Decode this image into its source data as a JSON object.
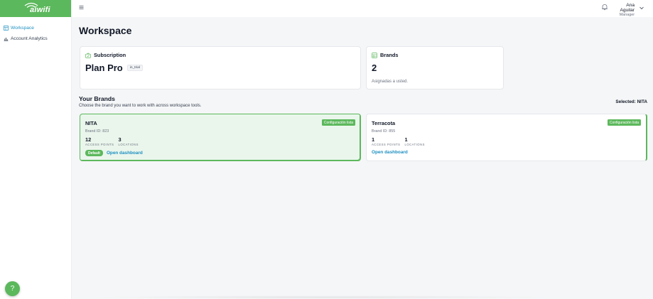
{
  "app": {
    "logo_text": "aiwifi",
    "brand_color": "#5cb85c",
    "link_color": "#1d8fc1"
  },
  "sidebar": {
    "items": [
      {
        "label": "Workspace",
        "icon": "workspace-icon",
        "active": true
      },
      {
        "label": "Account Analytics",
        "icon": "analytics-icon",
        "active": false
      }
    ],
    "help_label": "?"
  },
  "topbar": {
    "user_name": "Ana Aguilar",
    "user_role": "Manager"
  },
  "page": {
    "title": "Workspace"
  },
  "subscription": {
    "heading": "Subscription",
    "plan": "Plan Pro",
    "status": "in_trial"
  },
  "brands_summary": {
    "heading": "Brands",
    "count": "2",
    "subtext": "Asignadas a usted."
  },
  "your_brands": {
    "title": "Your Brands",
    "subtitle": "Choose the brand you want to work with across workspace tools.",
    "selected_label": "Selected: NITA",
    "brands": [
      {
        "name": "NITA",
        "badge": "Configuración lista",
        "brand_id": "Brand ID: 823",
        "access_points": "12",
        "access_points_label": "ACCESS POINTS",
        "locations": "3",
        "locations_label": "LOCATIONS",
        "default_label": "Default",
        "open_label": "Open dashboard"
      },
      {
        "name": "Terracota",
        "badge": "Configuración lista",
        "brand_id": "Brand ID: 855",
        "access_points": "1",
        "access_points_label": "ACCESS POINTS",
        "locations": "1",
        "locations_label": "LOCATIONS",
        "open_label": "Open dashboard"
      }
    ]
  }
}
